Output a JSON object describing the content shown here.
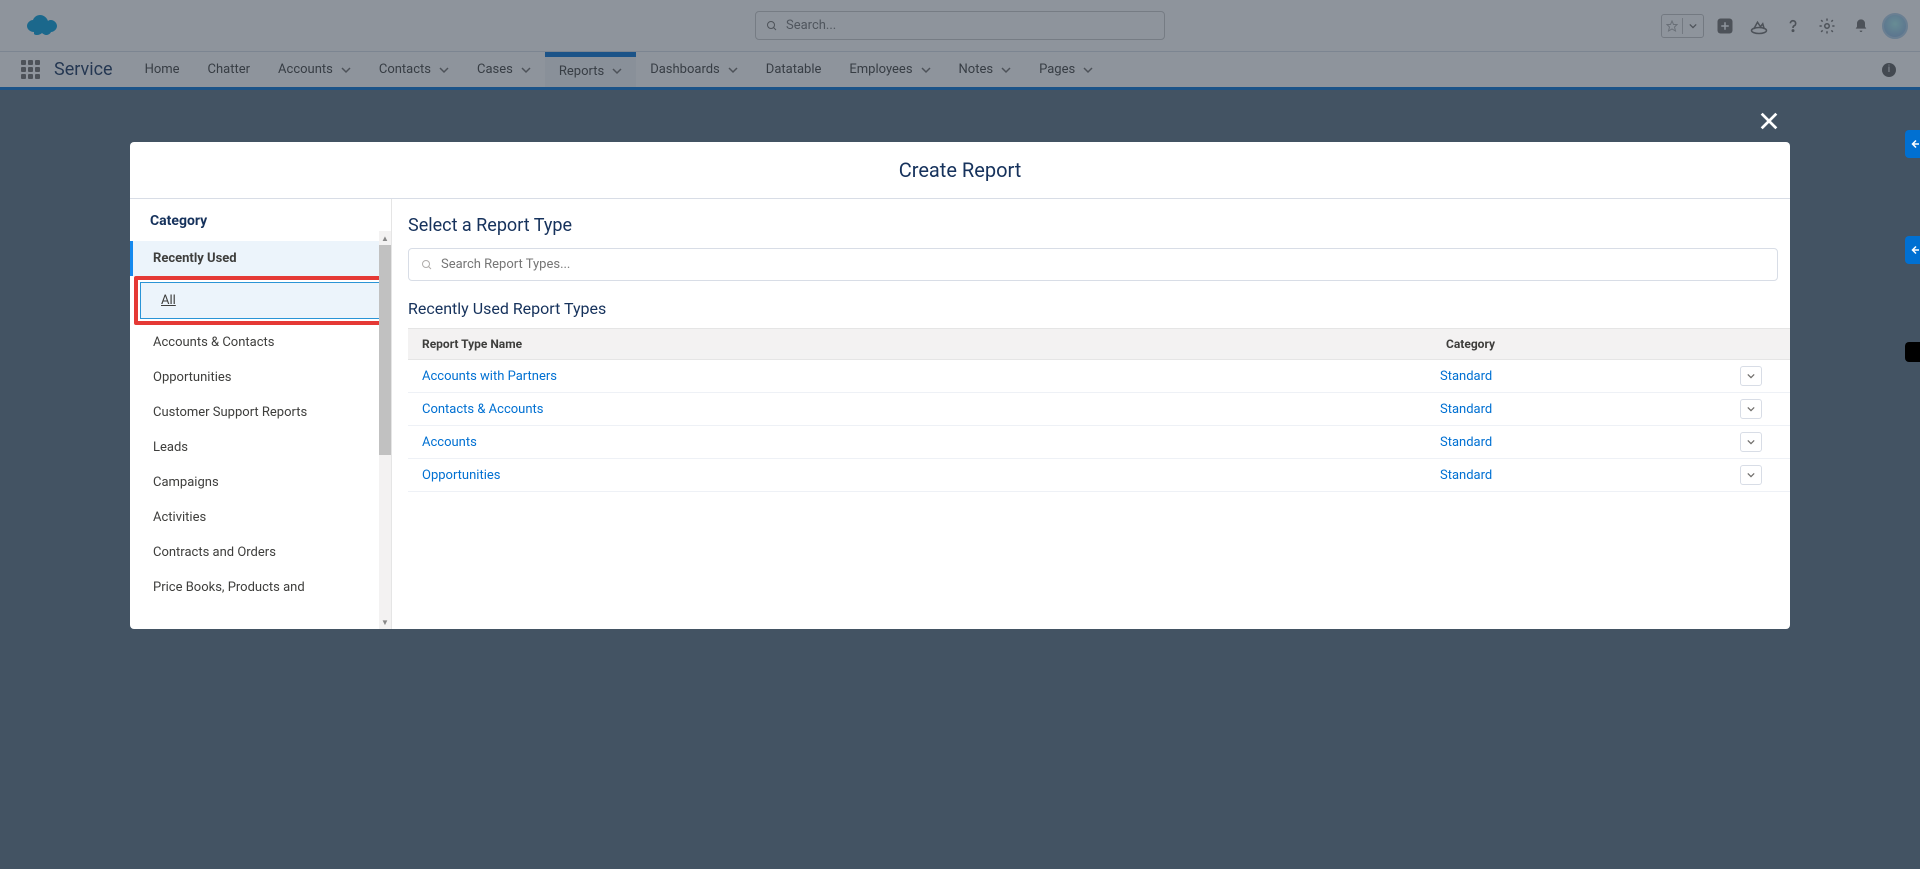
{
  "header": {
    "searchPlaceholder": "Search..."
  },
  "nav": {
    "appName": "Service",
    "items": [
      {
        "label": "Home",
        "hasMenu": false
      },
      {
        "label": "Chatter",
        "hasMenu": false
      },
      {
        "label": "Accounts",
        "hasMenu": true
      },
      {
        "label": "Contacts",
        "hasMenu": true
      },
      {
        "label": "Cases",
        "hasMenu": true
      },
      {
        "label": "Reports",
        "hasMenu": true,
        "active": true
      },
      {
        "label": "Dashboards",
        "hasMenu": true
      },
      {
        "label": "Datatable",
        "hasMenu": false
      },
      {
        "label": "Employees",
        "hasMenu": true
      },
      {
        "label": "Notes",
        "hasMenu": true
      },
      {
        "label": "Pages",
        "hasMenu": true
      }
    ]
  },
  "modal": {
    "title": "Create Report",
    "sidebarTitle": "Category",
    "categories": [
      {
        "label": "Recently Used",
        "selected": true
      },
      {
        "label": "All",
        "highlighted": true
      },
      {
        "label": "Accounts & Contacts"
      },
      {
        "label": "Opportunities"
      },
      {
        "label": "Customer Support Reports"
      },
      {
        "label": "Leads"
      },
      {
        "label": "Campaigns"
      },
      {
        "label": "Activities"
      },
      {
        "label": "Contracts and Orders"
      },
      {
        "label": "Price Books, Products and"
      }
    ],
    "panelHeading": "Select a Report Type",
    "searchPlaceholder": "Search Report Types...",
    "listHeading": "Recently Used Report Types",
    "columns": {
      "name": "Report Type Name",
      "category": "Category"
    },
    "rows": [
      {
        "name": "Accounts with Partners",
        "category": "Standard"
      },
      {
        "name": "Contacts & Accounts",
        "category": "Standard"
      },
      {
        "name": "Accounts",
        "category": "Standard"
      },
      {
        "name": "Opportunities",
        "category": "Standard"
      }
    ]
  }
}
